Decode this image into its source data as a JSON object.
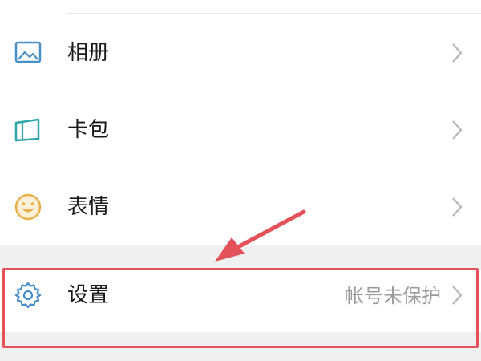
{
  "menu": {
    "items": [
      {
        "label": "相册",
        "icon": "album-icon"
      },
      {
        "label": "卡包",
        "icon": "wallet-icon"
      },
      {
        "label": "表情",
        "icon": "sticker-smile-icon"
      }
    ],
    "settings": {
      "label": "设置",
      "status": "帐号未保护",
      "icon": "gear-icon"
    }
  },
  "colors": {
    "accent_blue": "#4a90c8",
    "accent_teal": "#2fa6a8",
    "accent_yellow": "#e8b04a",
    "highlight_red": "#e25258",
    "chevron_gray": "#b5b5b5"
  }
}
